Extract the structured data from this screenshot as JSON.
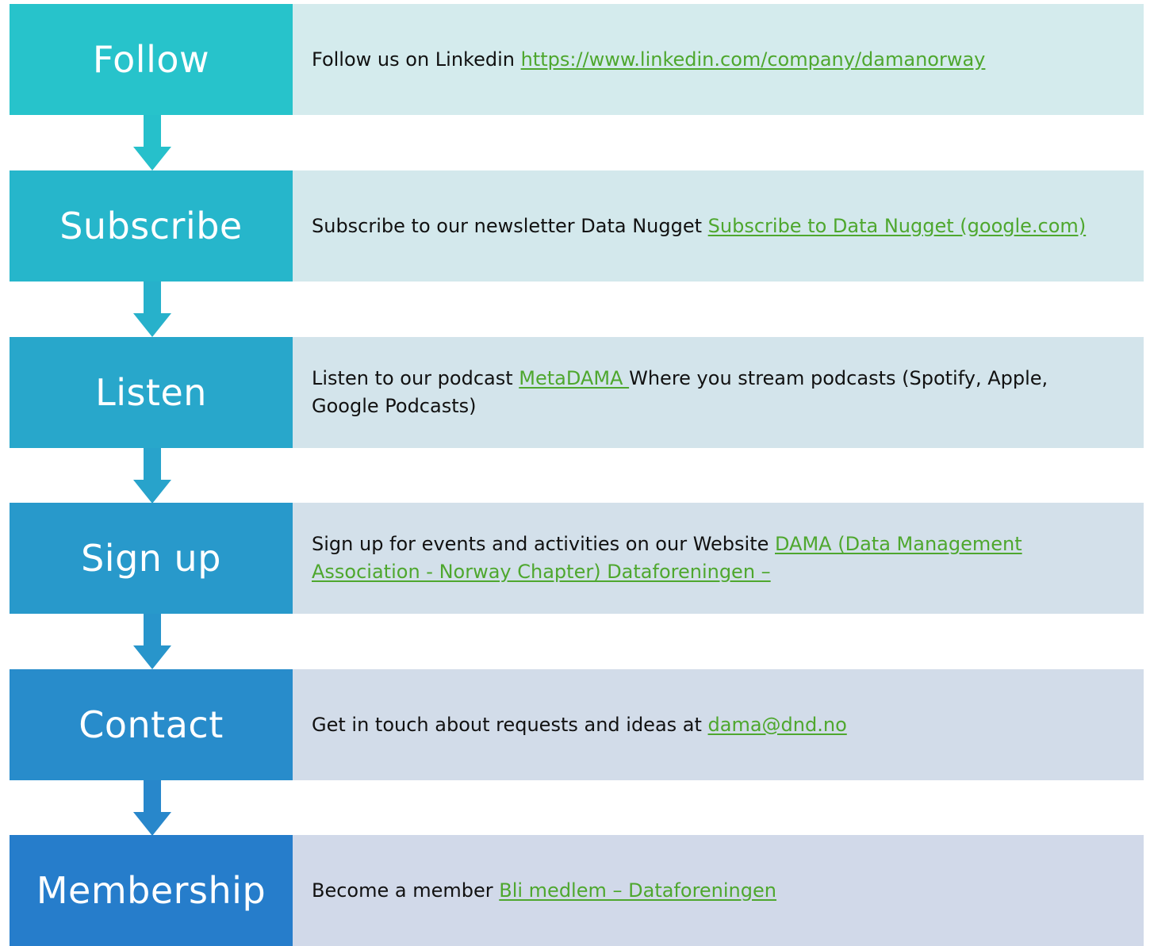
{
  "steps": [
    {
      "label": "Follow",
      "text": "Follow us on Linkedin ",
      "link": "https://www.linkedin.com/company/damanorway",
      "after": "",
      "label_color": "#27c3cb",
      "desc_color": "#d4ebed"
    },
    {
      "label": "Subscribe",
      "text": "Subscribe to our newsletter Data Nugget ",
      "link": "Subscribe to Data Nugget (google.com)",
      "after": "",
      "label_color": "#26b6cb",
      "desc_color": "#d3e8ec"
    },
    {
      "label": "Listen",
      "text": "Listen to our podcast ",
      "link": "MetaDAMA ",
      "after": "Where you stream podcasts (Spotify, Apple, Google Podcasts)",
      "label_color": "#28a7cb",
      "desc_color": "#d3e4eb"
    },
    {
      "label": "Sign up",
      "text": "Sign up for events and activities on our Website ",
      "link": "DAMA (Data Management Association - Norway Chapter) Dataforeningen –",
      "after": "",
      "label_color": "#2899cb",
      "desc_color": "#d3e0ea"
    },
    {
      "label": "Contact",
      "text": "Get in touch about requests and ideas at ",
      "link": "dama@dnd.no",
      "after": "",
      "label_color": "#288ccb",
      "desc_color": "#d2dce9"
    },
    {
      "label": "Membership",
      "text": "Become a member ",
      "link": "Bli medlem – Dataforeningen",
      "after": "",
      "label_color": "#267dcb",
      "desc_color": "#d1d9e9"
    }
  ],
  "arrows": [
    {
      "color": "#26c0cb"
    },
    {
      "color": "#27b1cb"
    },
    {
      "color": "#28a3cb"
    },
    {
      "color": "#2895cb"
    },
    {
      "color": "#2887cb"
    }
  ]
}
